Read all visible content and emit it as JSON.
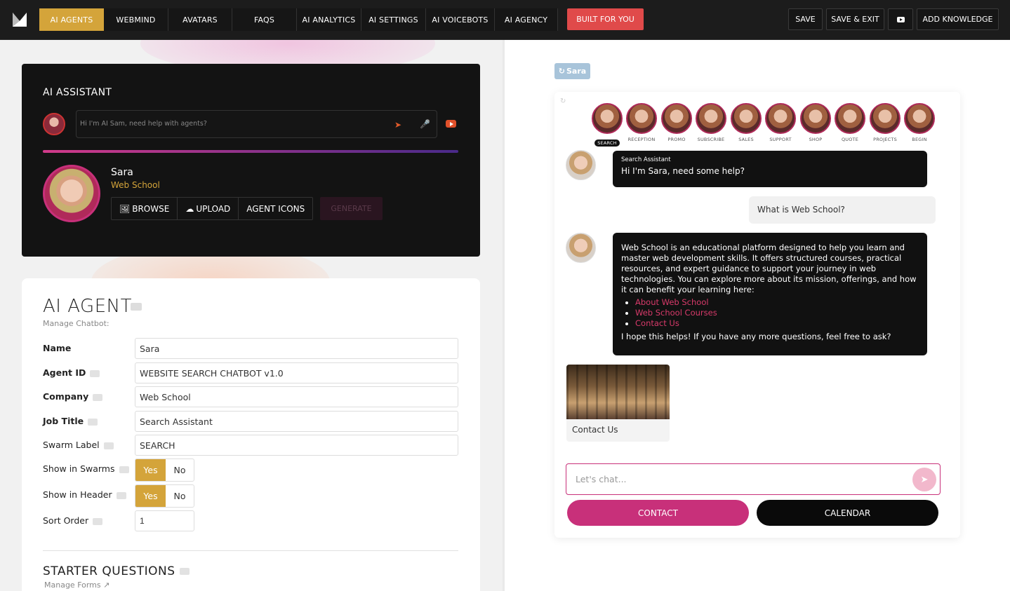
{
  "nav": {
    "tabs": [
      "AI AGENTS",
      "WEBMIND",
      "AVATARS",
      "FAQS",
      "AI ANALYTICS",
      "AI SETTINGS",
      "AI VOICEBOTS",
      "AI AGENCY"
    ],
    "built_label": "BUILT FOR YOU",
    "save_label": "SAVE",
    "save_exit_label": "SAVE & EXIT",
    "add_knowledge_label": "ADD KNOWLEDGE"
  },
  "assistant": {
    "title": "AI ASSISTANT",
    "placeholder": "Hi I'm AI Sam, need help with agents?",
    "agent_name": "Sara",
    "agent_company": "Web School",
    "browse_label": "BROWSE",
    "upload_label": "UPLOAD",
    "icons_label": "AGENT ICONS",
    "generate_label": "GENERATE"
  },
  "agent_form": {
    "title": "AI AGENT",
    "subtitle": "Manage Chatbot:",
    "fields": {
      "name_label": "Name",
      "name_value": "Sara",
      "agent_id_label": "Agent ID",
      "agent_id_value": "WEBSITE SEARCH CHATBOT v1.0",
      "company_label": "Company",
      "company_value": "Web School",
      "job_title_label": "Job Title",
      "job_title_value": "Search Assistant",
      "swarm_label_label": "Swarm Label",
      "swarm_label_value": "SEARCH",
      "show_swarms_label": "Show in Swarms",
      "show_header_label": "Show in Header",
      "sort_order_label": "Sort Order",
      "sort_order_value": "1"
    },
    "yes_label": "Yes",
    "no_label": "No",
    "starter_title": "STARTER QUESTIONS",
    "starter_sub": "Manage Forms"
  },
  "chat": {
    "badge": "Sara",
    "swarm": [
      "SEARCH",
      "RECEPTION",
      "PROMO",
      "SUBSCRIBE",
      "SALES",
      "SUPPORT",
      "SHOP",
      "QUOTE",
      "PROJECTS",
      "BEGIN"
    ],
    "msg1_role": "Search Assistant",
    "msg1_text": "Hi I'm Sara, need some help?",
    "user_msg": "What is Web School?",
    "msg2_text": "Web School is an educational platform designed to help you learn and master web development skills. It offers structured courses, practical resources, and expert guidance to support your journey in web technologies. You can explore more about its mission, offerings, and how it can benefit your learning here:",
    "links": [
      "About Web School",
      "Web School Courses",
      "Contact Us"
    ],
    "msg2_footer": "I hope this helps! If you have any more questions, feel free to ask?",
    "card_label": "Contact Us",
    "input_placeholder": "Let's chat...",
    "contact_label": "CONTACT",
    "calendar_label": "CALENDAR"
  },
  "colors": {
    "gold": "#d4a43a",
    "pink": "#c8307a",
    "red": "#e04a4a",
    "dark": "#131313"
  }
}
